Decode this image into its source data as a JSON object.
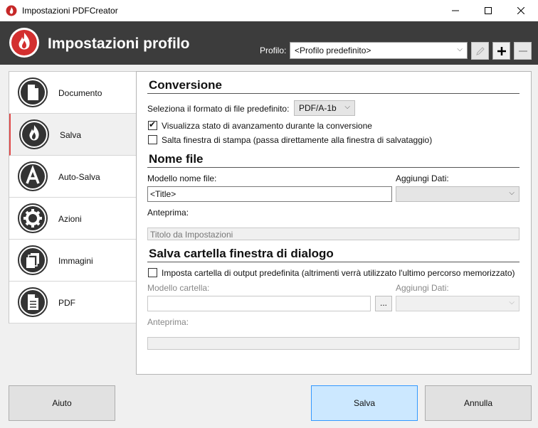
{
  "window": {
    "title": "Impostazioni PDFCreator"
  },
  "header": {
    "title": "Impostazioni profilo",
    "profile_label": "Profilo:",
    "profile_value": "<Profilo predefinito>"
  },
  "sidebar": {
    "items": [
      {
        "label": "Documento",
        "icon": "document-icon"
      },
      {
        "label": "Salva",
        "icon": "fire-icon",
        "active": true
      },
      {
        "label": "Auto-Salva",
        "icon": "auto-save-icon"
      },
      {
        "label": "Azioni",
        "icon": "gear-icon"
      },
      {
        "label": "Immagini",
        "icon": "images-icon"
      },
      {
        "label": "PDF",
        "icon": "pdf-document-icon"
      }
    ]
  },
  "conversione": {
    "title": "Conversione",
    "format_label": "Seleziona il formato di file predefinito:",
    "format_value": "PDF/A-1b",
    "progress_label": "Visualizza stato di avanzamento durante la conversione",
    "progress_checked": true,
    "skip_label": "Salta finestra di stampa (passa direttamente alla finestra di salvataggio)",
    "skip_checked": false
  },
  "nomefile": {
    "title": "Nome file",
    "template_label": "Modello nome file:",
    "template_value": "<Title>",
    "add_label": "Aggiungi Dati:",
    "preview_label": "Anteprima:",
    "preview_value": "Titolo da Impostazioni"
  },
  "cartella": {
    "title": "Salva cartella finestra di dialogo",
    "default_label": "Imposta cartella di output predefinita (altrimenti verrà utilizzato l'ultimo percorso memorizzato)",
    "default_checked": false,
    "folder_label": "Modello cartella:",
    "browse_label": "...",
    "add_label": "Aggiungi Dati:",
    "preview_label": "Anteprima:"
  },
  "footer": {
    "help": "Aiuto",
    "save": "Salva",
    "cancel": "Annulla"
  },
  "colors": {
    "header_bg": "#3c3c3c",
    "accent": "#e04a4a",
    "primary_button": "#cce8ff"
  }
}
